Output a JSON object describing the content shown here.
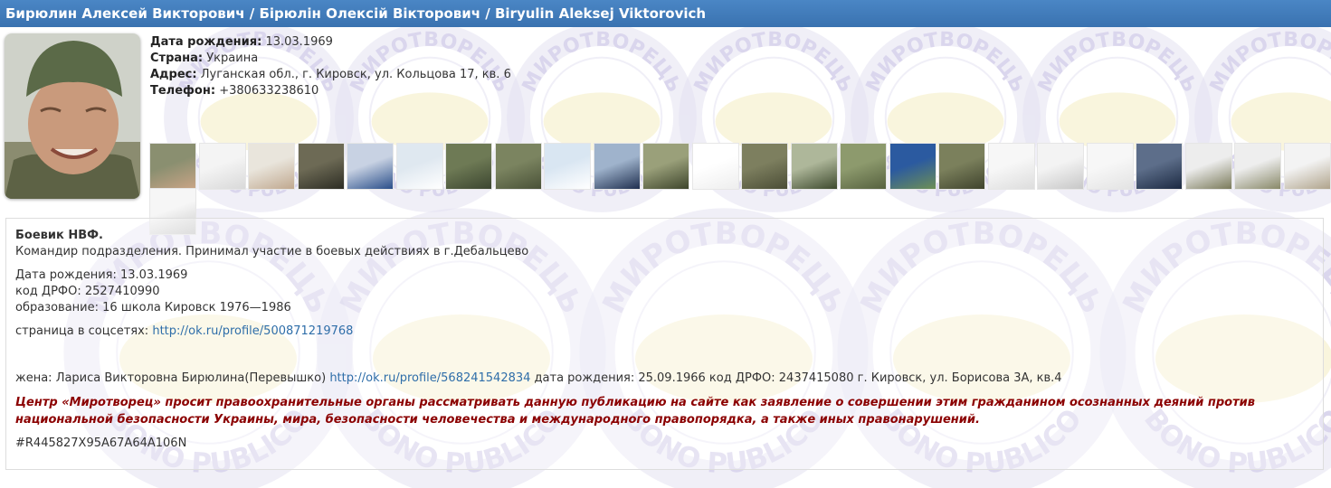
{
  "title": "Бирюлин Алексей Викторович / Бірюлін Олексій Вікторович / Biryulin Aleksej Viktorovich",
  "watermark": {
    "top_text": "МИРОТВОРЕЦЬ",
    "bottom_text": "BONO PUBLICO",
    "colors": {
      "ring": "#e4e2f2",
      "text": "#bdb5df",
      "map": "#f5eec3"
    }
  },
  "profile": {
    "birth_label": "Дата рождения:",
    "birth_value": "13.03.1969",
    "country_label": "Страна:",
    "country_value": "Украина",
    "address_label": "Адрес:",
    "address_value": "Луганская обл., г. Кировск, ул. Кольцова 17, кв. 6",
    "phone_label": "Телефон:",
    "phone_value": "+380633238610"
  },
  "gallery_count": 25,
  "description": {
    "heading": "Боевик НВФ.",
    "summary": "Командир подразделения. Принимал участие в боевых действиях в г.Дебальцево",
    "birth": "Дата рождения: 13.03.1969",
    "drfo": "код ДРФО: 2527410990",
    "education": "образование: 16 школа Кировск 1976—1986",
    "social_label": "страница в соцсетях: ",
    "social_link": "http://ok.ru/profile/500871219768",
    "wife_prefix": "жена: Лариса Викторовна Бирюлина(Перевышко) ",
    "wife_link": "http://ok.ru/profile/568241542834",
    "wife_suffix": " дата рождения: 25.09.1966 код ДРФО: 2437415080 г. Кировск, ул. Борисова 3А, кв.4",
    "warning": "Центр «Миротворец» просит правоохранительные органы рассматривать данную публикацию на сайте как заявление о совершении этим гражданином осознанных деяний против национальной безопасности Украины, мира, безопасности человечества и международного правопорядка, а также иных правонарушений.",
    "hash": "#R445827X95A67A64A106N"
  }
}
